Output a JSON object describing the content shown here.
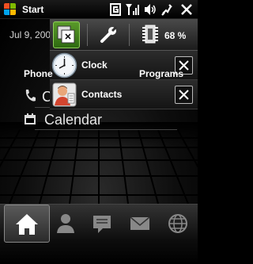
{
  "statusbar": {
    "title": "Start",
    "icons": [
      "data-connection-icon",
      "signal-strength-icon",
      "volume-icon",
      "battery-charging-icon",
      "close-icon"
    ]
  },
  "home": {
    "date": "Jul 9, 200",
    "contact_partial": "C",
    "calendar_label": "Calendar"
  },
  "task_manager": {
    "toolbar": {
      "tasks_icon": "task-switch-icon",
      "settings_icon": "wrench-icon",
      "memory_icon": "memory-chip-icon",
      "battery_percent": "68 %"
    },
    "tasks": [
      {
        "label": "Clock",
        "icon": "clock-icon"
      },
      {
        "label": "Contacts",
        "icon": "contacts-icon"
      }
    ]
  },
  "bottom_tabs": [
    {
      "name": "home",
      "icon": "home-icon"
    },
    {
      "name": "people",
      "icon": "person-icon"
    },
    {
      "name": "messages",
      "icon": "message-icon"
    },
    {
      "name": "email",
      "icon": "envelope-icon"
    },
    {
      "name": "internet",
      "icon": "globe-icon"
    }
  ],
  "softkeys": {
    "left": "Phone",
    "right": "Programs"
  },
  "colors": {
    "accent_green": "#5a9a2a",
    "background": "#000000"
  }
}
